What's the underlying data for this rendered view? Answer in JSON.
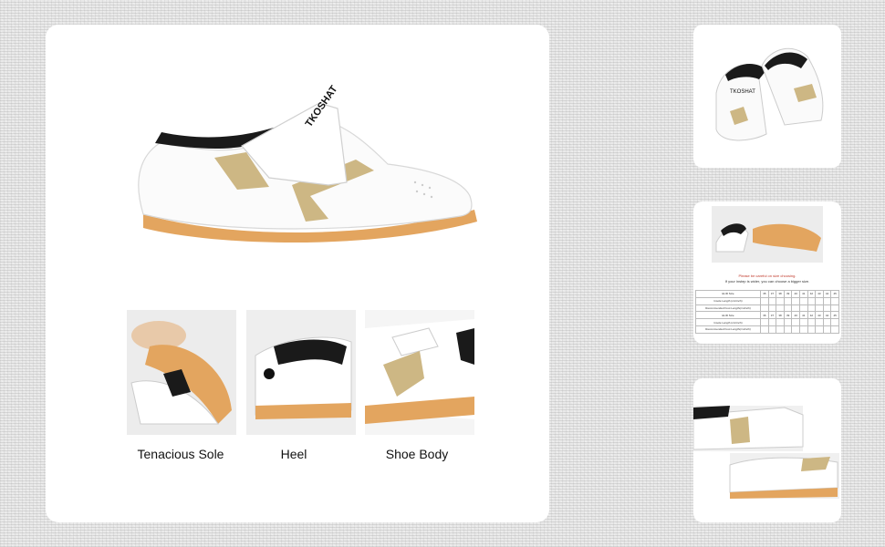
{
  "captions": {
    "sole": "Tenacious Sole",
    "heel": "Heel",
    "body": "Shoe Body"
  },
  "brand": {
    "shoe_text": "TKOSHAT",
    "thumb_text": "TKOSHAT"
  },
  "size_note": {
    "line1": "Please be careful on size choosing.",
    "line2": "If your instep is wider, you can choose a bigger size."
  },
  "size_table": {
    "rows": [
      [
        "EUR Size",
        "35",
        "37",
        "38",
        "39",
        "40",
        "41",
        "42",
        "43",
        "44",
        "45"
      ],
      [
        "Insole Length (cm/inch)",
        "",
        "",
        "",
        "",
        "",
        "",
        "",
        "",
        "",
        ""
      ],
      [
        "Recommended Foot Length(cm/inch)",
        "",
        "",
        "",
        "",
        "",
        "",
        "",
        "",
        "",
        ""
      ],
      [
        "EUR Size",
        "36",
        "37",
        "38",
        "39",
        "40",
        "41",
        "42",
        "43",
        "44",
        "45"
      ],
      [
        "Insole Length (cm/inch)",
        "",
        "",
        "",
        "",
        "",
        "",
        "",
        "",
        "",
        ""
      ],
      [
        "Recommended Foot Length(cm/inch)",
        "",
        "",
        "",
        "",
        "",
        "",
        "",
        "",
        "",
        ""
      ]
    ]
  },
  "colors": {
    "leather": "#ffffff",
    "gold": "#c9b27a",
    "sole": "#e0a25a",
    "lining": "#1a1a1a"
  }
}
